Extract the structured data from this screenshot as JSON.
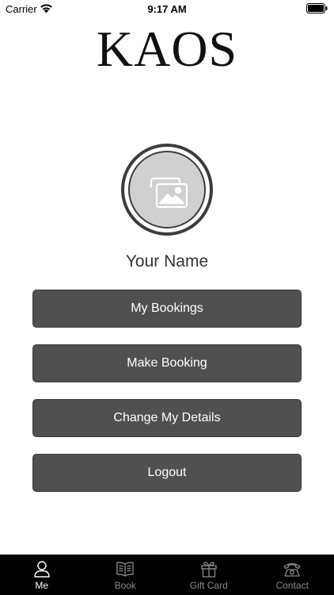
{
  "status_bar": {
    "carrier": "Carrier",
    "time": "9:17 AM",
    "wifi_icon": "wifi-icon",
    "battery_icon": "battery-icon"
  },
  "header": {
    "logo_text": "KAOS"
  },
  "profile": {
    "avatar_icon": "image-placeholder-icon",
    "name": "Your Name"
  },
  "menu": {
    "my_bookings": "My Bookings",
    "make_booking": "Make Booking",
    "change_details": "Change My Details",
    "logout": "Logout"
  },
  "tabs": [
    {
      "label": "Me",
      "icon": "person-icon",
      "active": true
    },
    {
      "label": "Book",
      "icon": "book-icon",
      "active": false
    },
    {
      "label": "Gift Card",
      "icon": "gift-icon",
      "active": false
    },
    {
      "label": "Contact",
      "icon": "phone-icon",
      "active": false
    }
  ],
  "colors": {
    "button_bg": "#505050",
    "tab_bar_bg": "#000000",
    "tab_active": "#ffffff",
    "tab_inactive": "#8a8a8a"
  }
}
